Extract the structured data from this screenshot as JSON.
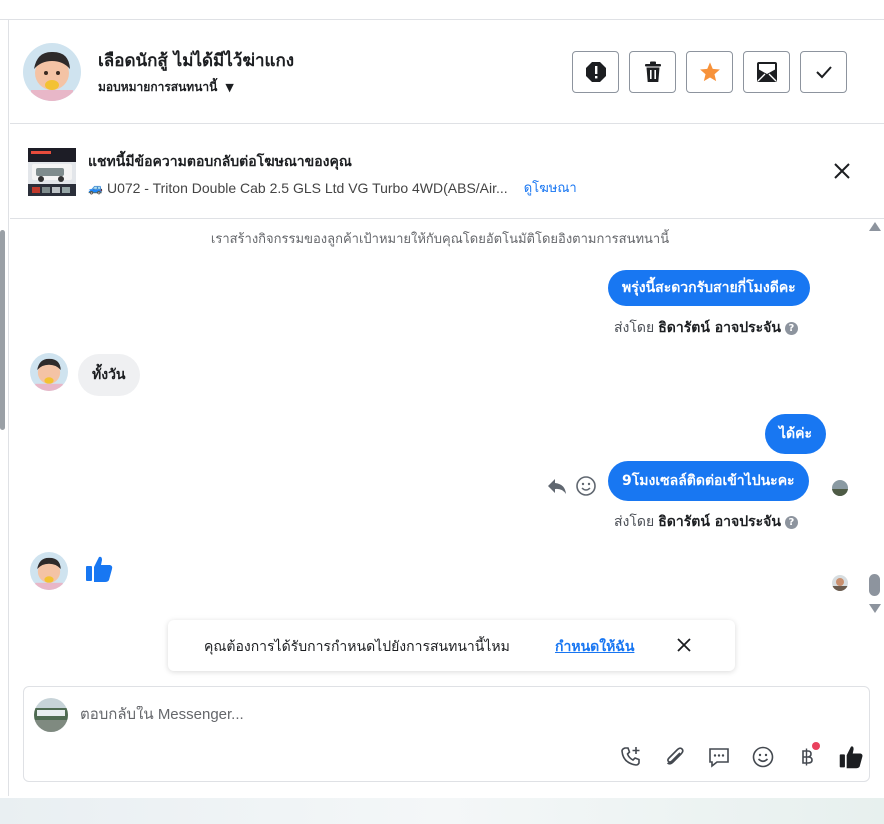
{
  "header": {
    "contact_name": "เลือดนักสู้ ไม่ได้มีไว้ฆ่าแกง",
    "assign_label": "มอบหมายการสนทนานี้",
    "actions": [
      "spam-icon",
      "trash-icon",
      "star-icon",
      "mark-unread-icon",
      "done-icon"
    ]
  },
  "ad": {
    "title": "แชทนี้มีข้อความตอบกลับต่อโฆษณาของคุณ",
    "subtitle": "U072 - Triton Double Cab 2.5 GLS Ltd VG Turbo 4WD(ABS/Air...",
    "link": "ดูโฆษณา"
  },
  "thread": {
    "system_note": "เราสร้างกิจกรรมของลูกค้าเป้าหมายให้กับคุณโดยอัตโนมัติโดยอิงตามการสนทนานี้",
    "messages": [
      {
        "direction": "out",
        "text": "พรุ่งนี้สะดวกรับสายกี่โมงดีคะ"
      },
      {
        "direction": "in",
        "text": "ทั้งวัน"
      },
      {
        "direction": "out",
        "text": "ได้ค่ะ"
      },
      {
        "direction": "out",
        "text": "9โมงเซลล์ติดต่อเข้าไปนะคะ"
      },
      {
        "direction": "in",
        "text": "like-icon"
      }
    ],
    "sent_by_label": "ส่งโดย",
    "sent_by_name": "ธิดารัตน์ อาจประจัน",
    "help_mark": "?"
  },
  "prompt": {
    "text": "คุณต้องการได้รับการกำหนดไปยังการสนทนานี้ไหม",
    "link": "กำหนดให้ฉัน"
  },
  "composer": {
    "placeholder": "ตอบกลับใน Messenger...",
    "tools": [
      "add-call-icon",
      "attachment-icon",
      "saved-reply-icon",
      "emoji-icon",
      "baht-payment-icon",
      "like-icon"
    ]
  },
  "colors": {
    "accent": "#1877f2",
    "bubble_in": "#eff0f2",
    "star": "#f7923a",
    "notification": "#e9415d"
  }
}
